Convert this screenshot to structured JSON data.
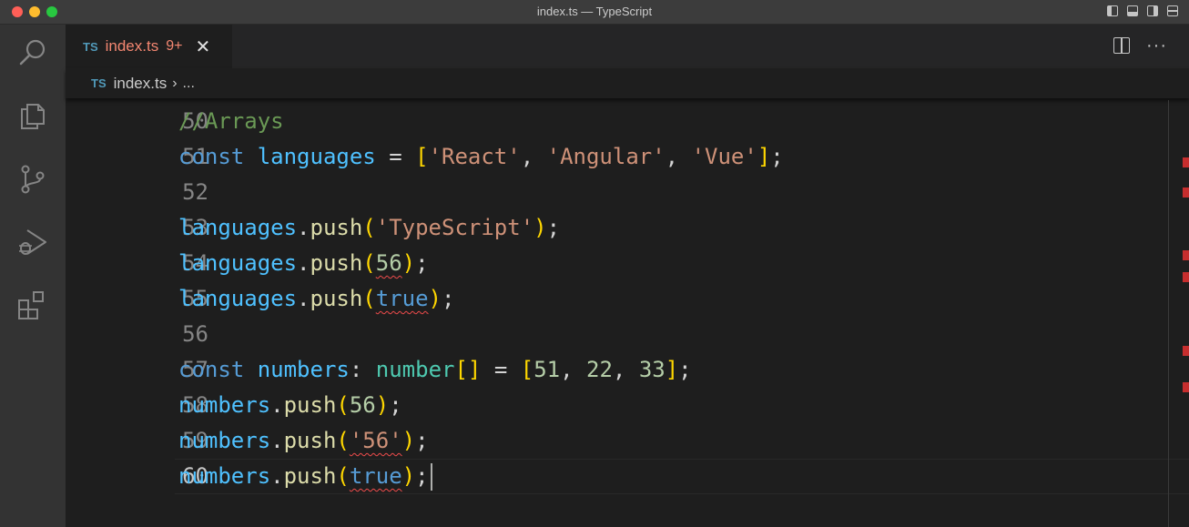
{
  "window": {
    "title": "index.ts — TypeScript"
  },
  "tab": {
    "lang_badge": "TS",
    "filename": "index.ts",
    "problems": "9+",
    "close": "✕"
  },
  "breadcrumb": {
    "lang_badge": "TS",
    "filename": "index.ts",
    "separator": "›",
    "more": "..."
  },
  "editor": {
    "active_line": "60",
    "lines": [
      {
        "n": "50",
        "tokens": [
          {
            "t": "//Arrays",
            "c": "comment"
          }
        ]
      },
      {
        "n": "51",
        "tokens": [
          {
            "t": "const",
            "c": "keyword"
          },
          {
            "t": " ",
            "c": "op"
          },
          {
            "t": "languages",
            "c": "var"
          },
          {
            "t": " = ",
            "c": "op"
          },
          {
            "t": "[",
            "c": "br1"
          },
          {
            "t": "'React'",
            "c": "str"
          },
          {
            "t": ", ",
            "c": "op"
          },
          {
            "t": "'Angular'",
            "c": "str"
          },
          {
            "t": ", ",
            "c": "op"
          },
          {
            "t": "'Vue'",
            "c": "str"
          },
          {
            "t": "]",
            "c": "br1"
          },
          {
            "t": ";",
            "c": "op"
          }
        ]
      },
      {
        "n": "52",
        "tokens": []
      },
      {
        "n": "53",
        "tokens": [
          {
            "t": "languages",
            "c": "var"
          },
          {
            "t": ".",
            "c": "op"
          },
          {
            "t": "push",
            "c": "fn"
          },
          {
            "t": "(",
            "c": "br1"
          },
          {
            "t": "'TypeScript'",
            "c": "str"
          },
          {
            "t": ")",
            "c": "br1"
          },
          {
            "t": ";",
            "c": "op"
          }
        ]
      },
      {
        "n": "54",
        "tokens": [
          {
            "t": "languages",
            "c": "var"
          },
          {
            "t": ".",
            "c": "op"
          },
          {
            "t": "push",
            "c": "fn"
          },
          {
            "t": "(",
            "c": "br1"
          },
          {
            "t": "56",
            "c": "num",
            "err": true
          },
          {
            "t": ")",
            "c": "br1"
          },
          {
            "t": ";",
            "c": "op"
          }
        ]
      },
      {
        "n": "55",
        "tokens": [
          {
            "t": "languages",
            "c": "var"
          },
          {
            "t": ".",
            "c": "op"
          },
          {
            "t": "push",
            "c": "fn"
          },
          {
            "t": "(",
            "c": "br1"
          },
          {
            "t": "true",
            "c": "bool",
            "err": true
          },
          {
            "t": ")",
            "c": "br1"
          },
          {
            "t": ";",
            "c": "op"
          }
        ]
      },
      {
        "n": "56",
        "tokens": []
      },
      {
        "n": "57",
        "tokens": [
          {
            "t": "const",
            "c": "keyword"
          },
          {
            "t": " ",
            "c": "op"
          },
          {
            "t": "numbers",
            "c": "var"
          },
          {
            "t": ": ",
            "c": "op"
          },
          {
            "t": "number",
            "c": "type"
          },
          {
            "t": "[]",
            "c": "br1"
          },
          {
            "t": " = ",
            "c": "op"
          },
          {
            "t": "[",
            "c": "br1"
          },
          {
            "t": "51",
            "c": "num"
          },
          {
            "t": ", ",
            "c": "op"
          },
          {
            "t": "22",
            "c": "num"
          },
          {
            "t": ", ",
            "c": "op"
          },
          {
            "t": "33",
            "c": "num"
          },
          {
            "t": "]",
            "c": "br1"
          },
          {
            "t": ";",
            "c": "op"
          }
        ]
      },
      {
        "n": "58",
        "tokens": [
          {
            "t": "numbers",
            "c": "var"
          },
          {
            "t": ".",
            "c": "op"
          },
          {
            "t": "push",
            "c": "fn"
          },
          {
            "t": "(",
            "c": "br1"
          },
          {
            "t": "56",
            "c": "num"
          },
          {
            "t": ")",
            "c": "br1"
          },
          {
            "t": ";",
            "c": "op"
          }
        ]
      },
      {
        "n": "59",
        "tokens": [
          {
            "t": "numbers",
            "c": "var"
          },
          {
            "t": ".",
            "c": "op"
          },
          {
            "t": "push",
            "c": "fn"
          },
          {
            "t": "(",
            "c": "br1"
          },
          {
            "t": "'56'",
            "c": "str",
            "err": true
          },
          {
            "t": ")",
            "c": "br1"
          },
          {
            "t": ";",
            "c": "op"
          }
        ]
      },
      {
        "n": "60",
        "tokens": [
          {
            "t": "numbers",
            "c": "var"
          },
          {
            "t": ".",
            "c": "op"
          },
          {
            "t": "push",
            "c": "fn"
          },
          {
            "t": "(",
            "c": "br1"
          },
          {
            "t": "true",
            "c": "bool",
            "err": true
          },
          {
            "t": ")",
            "c": "br1"
          },
          {
            "t": ";",
            "c": "op"
          }
        ]
      }
    ]
  },
  "colors": {
    "accent": "#519aba",
    "error": "#f14c4c",
    "tab_error_text": "#f48771"
  },
  "activity_icons": [
    "search-icon",
    "explorer-icon",
    "source-control-icon",
    "run-debug-icon",
    "extensions-icon"
  ]
}
